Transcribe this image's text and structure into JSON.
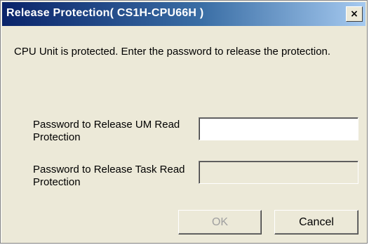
{
  "window": {
    "title": "Release Protection( CS1H-CPU66H )",
    "close_icon": "close-icon",
    "close_glyph": "×"
  },
  "message": "CPU Unit is protected. Enter the password to release the protection.",
  "fields": {
    "um_label": "Password to Release UM Read Protection",
    "um_value": "",
    "task_label": "Password to Release Task Read Protection",
    "task_value": ""
  },
  "buttons": {
    "ok_label": "OK",
    "cancel_label": "Cancel"
  },
  "colors": {
    "dialog_bg": "#ece9d8",
    "title_gradient_start": "#0a246a",
    "title_gradient_end": "#a6caf0",
    "disabled_text": "#a0a0a0"
  }
}
